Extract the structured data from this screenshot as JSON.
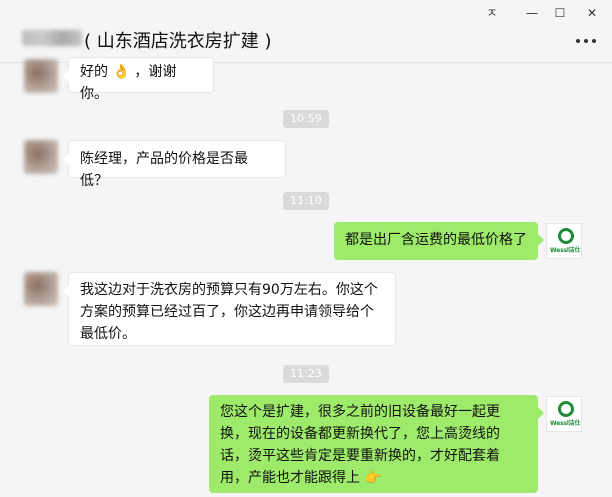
{
  "window": {
    "title": "( 山东酒店洗衣房扩建 )",
    "pin_glyph": "ㅈ",
    "minimize_glyph": "—",
    "maximize_glyph": "☐",
    "close_glyph": "✕"
  },
  "contact": {
    "logo_text": "Wessl洁仕"
  },
  "messages": [
    {
      "type": "in",
      "text": "好的",
      "emoji": "👌",
      "text_after": "，谢谢你。"
    },
    {
      "type": "time",
      "text": "10:59"
    },
    {
      "type": "in",
      "text": "陈经理，产品的价格是否最低？"
    },
    {
      "type": "time",
      "text": "11:10"
    },
    {
      "type": "out",
      "text": "都是出厂含运费的最低价格了"
    },
    {
      "type": "in",
      "text": "我这边对于洗衣房的预算只有90万左右。你这个方案的预算已经过百了，你这边再申请领导给个最低价。"
    },
    {
      "type": "time",
      "text": "11:23"
    },
    {
      "type": "out",
      "text": "您这个是扩建，很多之前的旧设备最好一起更换，现在的设备都更新换代了，您上高烫线的话，烫平这些肯定是要重新换的，才好配套着用，产能也才能跟得上",
      "emoji": "👉"
    }
  ],
  "colors": {
    "background": "#f5f5f5",
    "incoming_bubble": "#ffffff",
    "outgoing_bubble": "#9eea6a",
    "timestamp_bg": "#dadada",
    "logo_green": "#1e8a3a"
  }
}
